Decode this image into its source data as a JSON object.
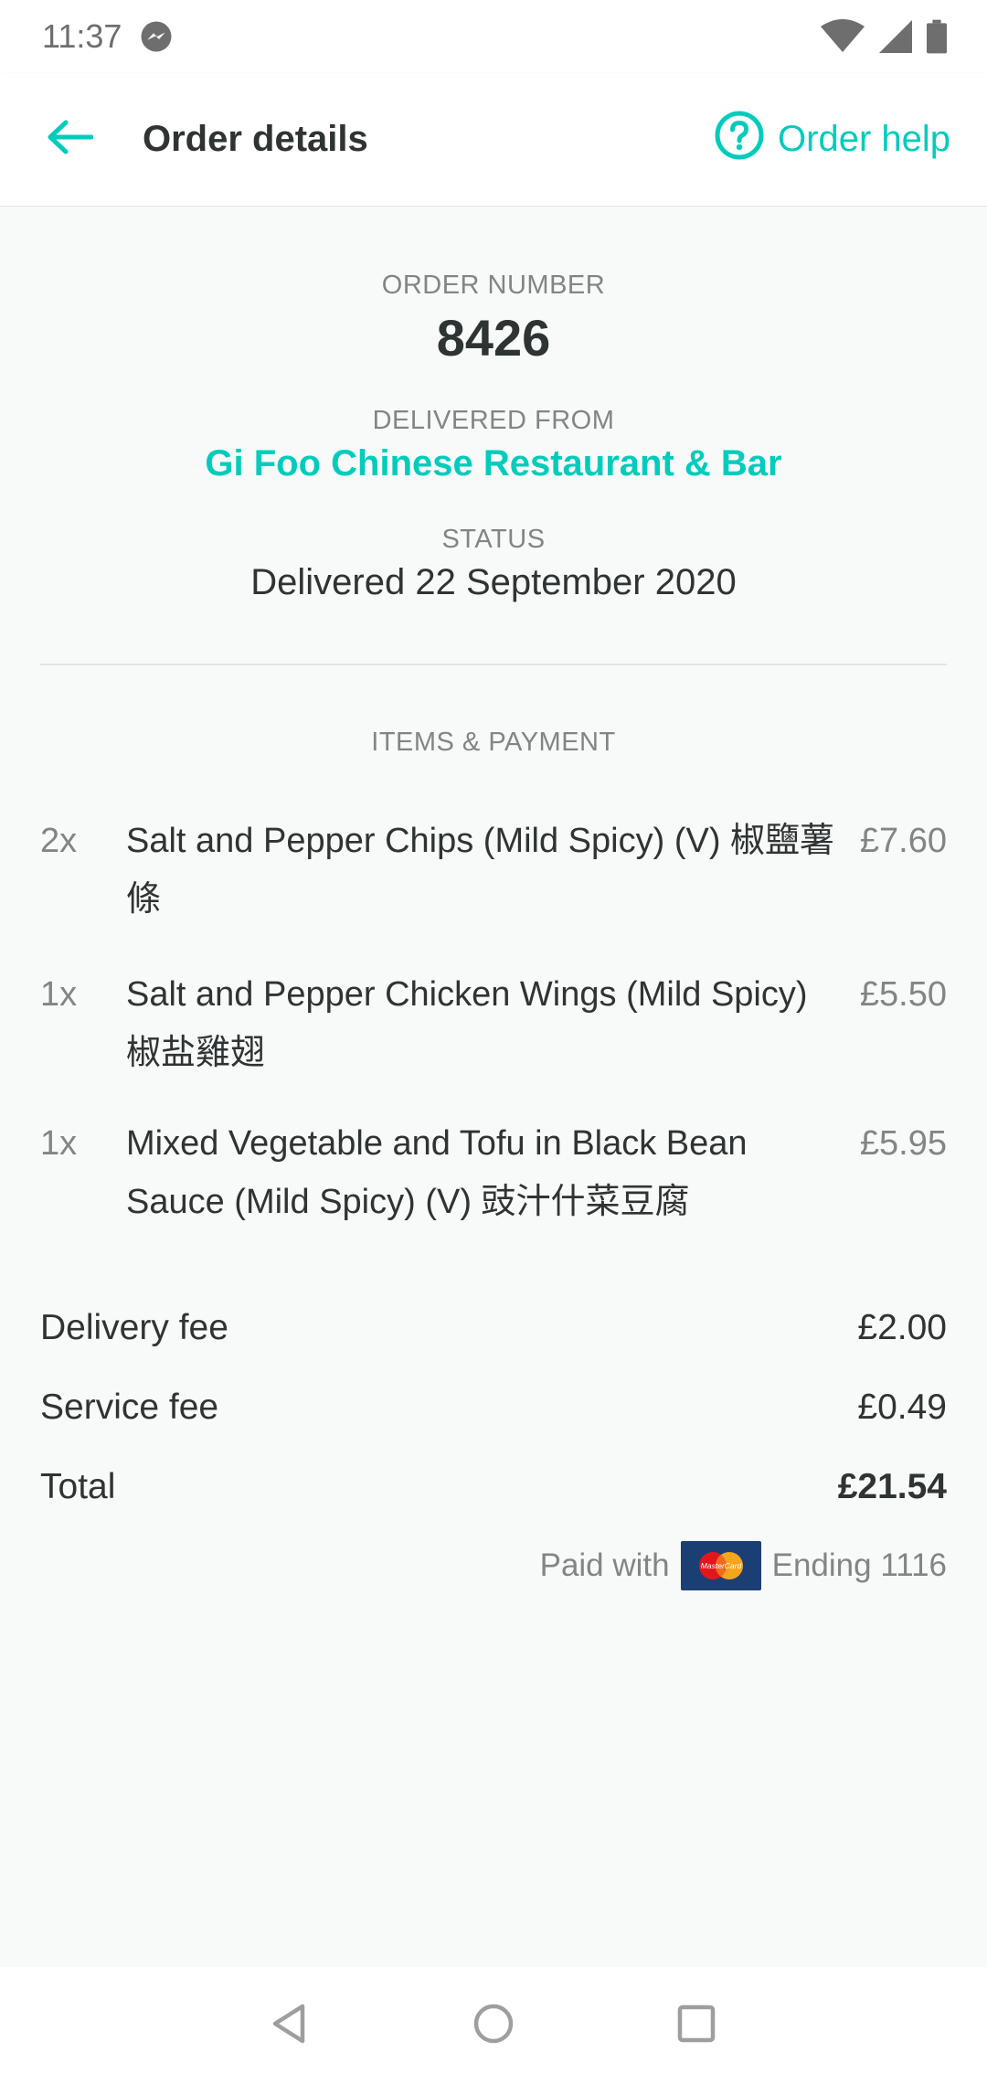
{
  "status_bar": {
    "time": "11:37",
    "icons": [
      "messenger-icon",
      "wifi-icon",
      "signal-icon",
      "battery-icon"
    ]
  },
  "app_bar": {
    "title": "Order details",
    "help_label": "Order help"
  },
  "order": {
    "number_label": "ORDER NUMBER",
    "number": "8426",
    "from_label": "DELIVERED FROM",
    "restaurant": "Gi Foo Chinese Restaurant & Bar",
    "status_label": "STATUS",
    "status": "Delivered 22 September 2020"
  },
  "items_section": {
    "heading": "ITEMS & PAYMENT",
    "items": [
      {
        "qty": "2x",
        "name": "Salt and Pepper Chips (Mild Spicy) (V) 椒鹽薯條",
        "price": "£7.60"
      },
      {
        "qty": "1x",
        "name": "Salt and Pepper Chicken Wings (Mild Spicy) 椒盐雞翅",
        "price": "£5.50"
      },
      {
        "qty": "1x",
        "name": "Mixed Vegetable and Tofu in Black Bean Sauce (Mild Spicy) (V) 豉汁什菜豆腐",
        "price": "£5.95"
      }
    ]
  },
  "fees": {
    "delivery_label": "Delivery fee",
    "delivery_value": "£2.00",
    "service_label": "Service fee",
    "service_value": "£0.49",
    "total_label": "Total",
    "total_value": "£21.54"
  },
  "payment": {
    "paid_with_label": "Paid with",
    "card_brand_text": "MasterCard",
    "ending": "Ending 1116"
  },
  "colors": {
    "accent": "#00ccbc",
    "text": "#2e3333",
    "muted": "#828585",
    "background": "#f8f9f9"
  }
}
